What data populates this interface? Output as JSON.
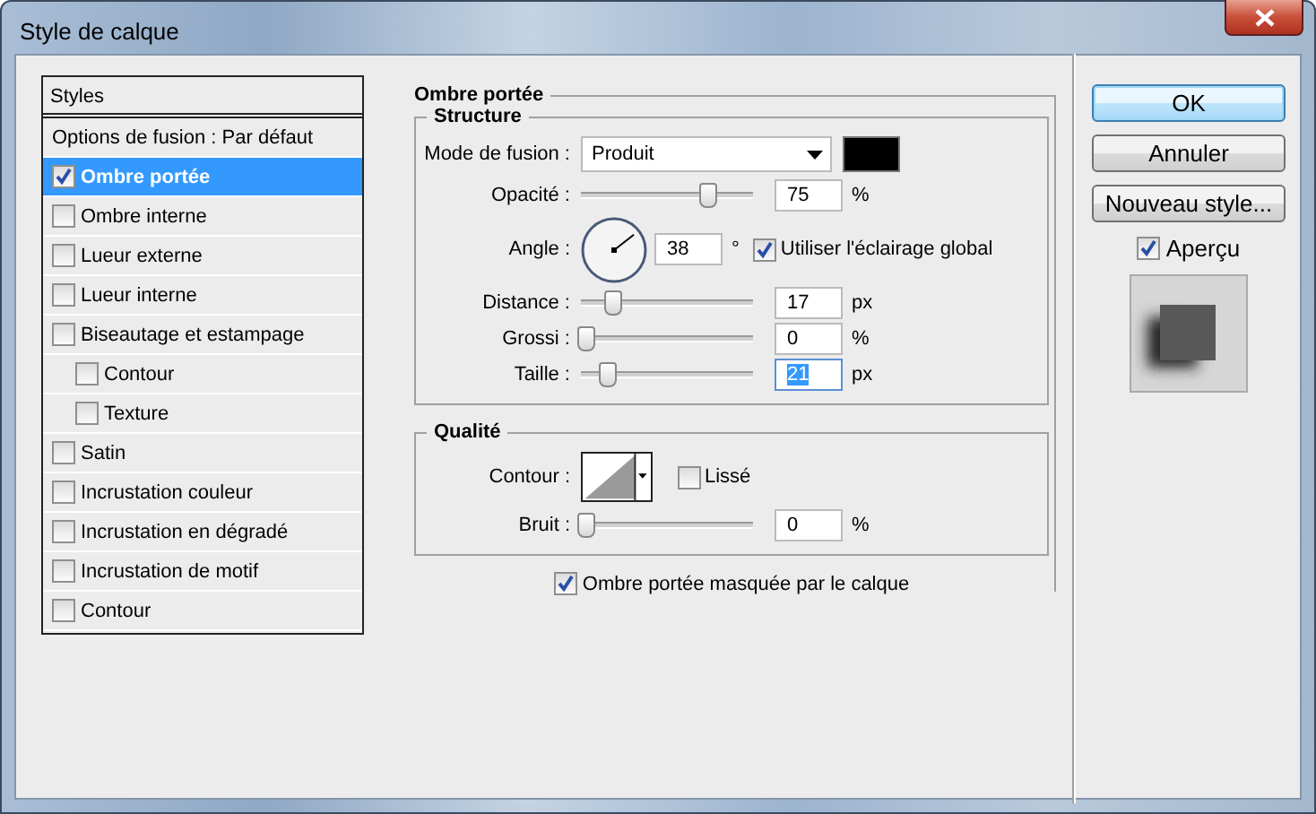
{
  "window": {
    "title": "Style de calque"
  },
  "styles": {
    "header": "Styles",
    "blending_options": "Options de fusion : Par défaut",
    "items": [
      {
        "label": "Ombre portée",
        "checked": true,
        "selected": true
      },
      {
        "label": "Ombre interne",
        "checked": false,
        "selected": false
      },
      {
        "label": "Lueur externe",
        "checked": false,
        "selected": false
      },
      {
        "label": "Lueur interne",
        "checked": false,
        "selected": false
      },
      {
        "label": "Biseautage et estampage",
        "checked": false,
        "selected": false,
        "children": [
          {
            "label": "Contour",
            "checked": false,
            "selected": false
          },
          {
            "label": "Texture",
            "checked": false,
            "selected": false
          }
        ]
      },
      {
        "label": "Satin",
        "checked": false,
        "selected": false
      },
      {
        "label": "Incrustation couleur",
        "checked": false,
        "selected": false
      },
      {
        "label": "Incrustation en dégradé",
        "checked": false,
        "selected": false
      },
      {
        "label": "Incrustation de motif",
        "checked": false,
        "selected": false
      },
      {
        "label": "Contour",
        "checked": false,
        "selected": false
      }
    ]
  },
  "panel": {
    "title": "Ombre portée",
    "structure": {
      "title": "Structure",
      "rows": [
        {
          "kind": "blend",
          "label": "Mode de fusion :",
          "value": "Produit"
        },
        {
          "kind": "slider",
          "label": "Opacité :",
          "level": 0.75,
          "value": "75",
          "unit": "%",
          "focused": false
        },
        {
          "kind": "angle",
          "label": "Angle :",
          "value": "38",
          "unit": "°",
          "global_light": {
            "label": "Utiliser l'éclairage global",
            "checked": true
          }
        },
        {
          "kind": "slider",
          "label": "Distance :",
          "level": 0.17,
          "value": "17",
          "unit": "px",
          "focused": false
        },
        {
          "kind": "slider",
          "label": "Grossi :",
          "level": 0,
          "value": "0",
          "unit": "%",
          "focused": false
        },
        {
          "kind": "slider",
          "label": "Taille :",
          "level": 0.13,
          "value": "21",
          "unit": "px",
          "focused": true
        }
      ]
    },
    "quality": {
      "title": "Qualité",
      "rows": [
        {
          "kind": "contour",
          "label": "Contour :",
          "smooth": {
            "label": "Lissé",
            "checked": false
          }
        },
        {
          "kind": "slider",
          "label": "Bruit :",
          "level": 0,
          "value": "0",
          "unit": "%",
          "focused": false
        }
      ]
    },
    "knockout": {
      "label": "Ombre portée masquée par le calque",
      "checked": true
    }
  },
  "buttons": [
    {
      "label": "OK",
      "default": true
    },
    {
      "label": "Annuler",
      "default": false
    },
    {
      "label": "Nouveau style...",
      "default": false
    }
  ],
  "preview": {
    "label": "Aperçu",
    "checked": true
  }
}
